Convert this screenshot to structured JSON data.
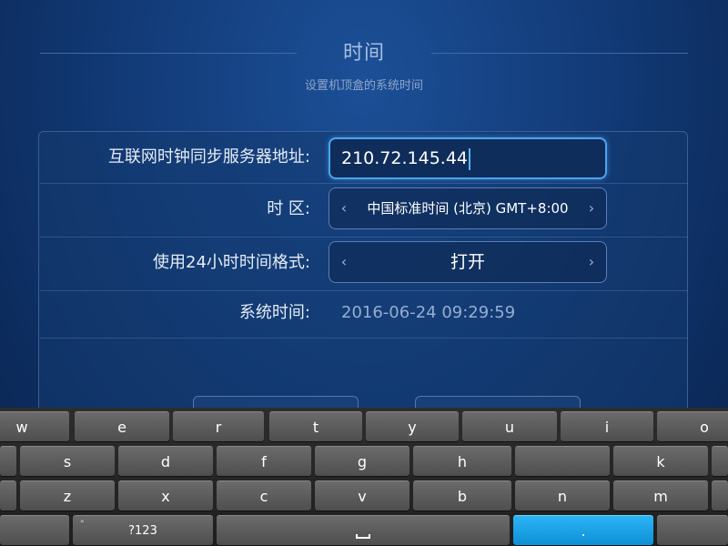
{
  "header": {
    "title": "时间",
    "subtitle": "设置机顶盒的系统时间"
  },
  "settings": {
    "ntp_server": {
      "label": "互联网时钟同步服务器地址:",
      "value": "210.72.145.44"
    },
    "timezone": {
      "label": "时 区:",
      "value": "中国标准时间 (北京) GMT+8:00",
      "arrow_left": "‹",
      "arrow_right": "›"
    },
    "format_24h": {
      "label": "使用24小时时间格式:",
      "value": "打开",
      "arrow_left": "‹",
      "arrow_right": "›"
    },
    "system_time": {
      "label": "系统时间:",
      "value": "2016-06-24 09:29:59"
    }
  },
  "keyboard": {
    "row1": [
      "w",
      "e",
      "r",
      "t",
      "y",
      "u",
      "i",
      "o"
    ],
    "row2": [
      "s",
      "d",
      "f",
      "g",
      "h",
      "k"
    ],
    "row3": [
      "z",
      "x",
      "c",
      "v",
      "b",
      "n",
      "m"
    ],
    "symbols_label": "?123",
    "symbols_marker": "°",
    "period_label": "."
  },
  "colors": {
    "background": "#123b78",
    "accent": "#4aa3ee",
    "keyboard_highlight": "#1aa3e8"
  }
}
